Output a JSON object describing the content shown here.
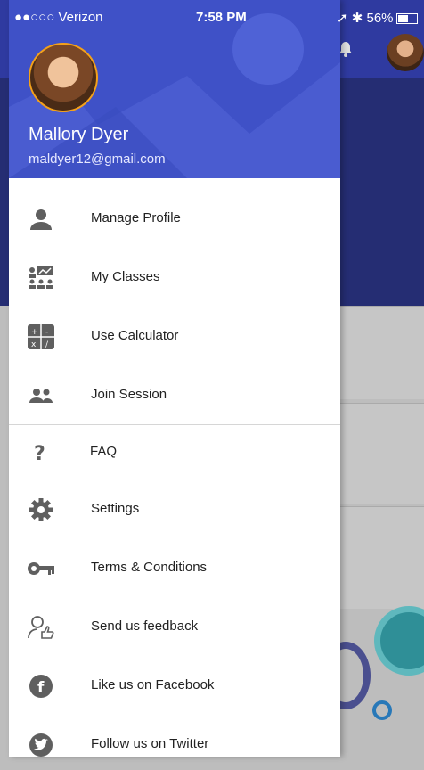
{
  "status_bar": {
    "carrier": "●●○○○ Verizon",
    "time": "7:58 PM",
    "battery": "56%"
  },
  "profile": {
    "name": "Mallory Dyer",
    "email": "maldyer12@gmail.com"
  },
  "menu": {
    "items": [
      {
        "label": "Manage Profile",
        "icon": "person-icon"
      },
      {
        "label": "My Classes",
        "icon": "classroom-icon"
      },
      {
        "label": "Use Calculator",
        "icon": "calculator-icon"
      },
      {
        "label": "Join Session",
        "icon": "group-icon"
      },
      {
        "label": "FAQ",
        "icon": "question-icon"
      },
      {
        "label": "Settings",
        "icon": "gear-icon"
      },
      {
        "label": "Terms & Conditions",
        "icon": "key-icon"
      },
      {
        "label": "Send us feedback",
        "icon": "feedback-icon"
      },
      {
        "label": "Like us on Facebook",
        "icon": "facebook-icon"
      },
      {
        "label": "Follow us on Twitter",
        "icon": "twitter-icon"
      }
    ]
  },
  "colors": {
    "drawer_header": "#3f51c7",
    "icon_gray": "#5f5f5f",
    "background_header": "#2f3aa0"
  }
}
